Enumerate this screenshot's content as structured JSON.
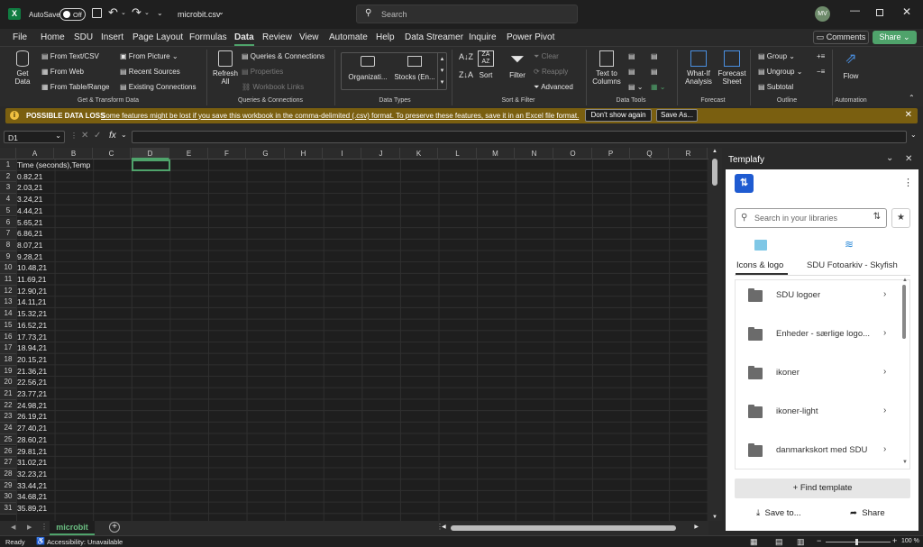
{
  "title_bar": {
    "autosave_label": "AutoSave",
    "autosave_state": "Off",
    "filename": "microbit.csv",
    "search_placeholder": "Search",
    "avatar_initials": "MV"
  },
  "menu_tabs": [
    "File",
    "Home",
    "SDU",
    "Insert",
    "Page Layout",
    "Formulas",
    "Data",
    "Review",
    "View",
    "Automate",
    "Help",
    "Data Streamer",
    "Inquire",
    "Power Pivot"
  ],
  "active_tab": "Data",
  "comments_label": "Comments",
  "share_label": "Share",
  "ribbon": {
    "get_data": "Get Data",
    "get_data_line1": "Get",
    "get_data_line2": "Data",
    "from_text_csv": "From Text/CSV",
    "from_web": "From Web",
    "from_table_range": "From Table/Range",
    "from_picture": "From Picture",
    "recent_sources": "Recent Sources",
    "existing_connections": "Existing Connections",
    "group_get_transform": "Get & Transform Data",
    "refresh_line1": "Refresh",
    "refresh_line2": "All",
    "queries_connections": "Queries & Connections",
    "properties": "Properties",
    "workbook_links": "Workbook Links",
    "group_queries": "Queries & Connections",
    "organization": "Organizati...",
    "stocks": "Stocks (En...",
    "group_data_types": "Data Types",
    "sort": "Sort",
    "filter": "Filter",
    "clear": "Clear",
    "reapply": "Reapply",
    "advanced": "Advanced",
    "group_sort_filter": "Sort & Filter",
    "text_to_columns_line1": "Text to",
    "text_to_columns_line2": "Columns",
    "group_data_tools": "Data Tools",
    "what_if_line1": "What-If",
    "what_if_line2": "Analysis",
    "forecast_line1": "Forecast",
    "forecast_line2": "Sheet",
    "group_forecast": "Forecast",
    "group": "Group",
    "ungroup": "Ungroup",
    "subtotal": "Subtotal",
    "group_outline": "Outline",
    "flow": "Flow",
    "group_automation": "Automation"
  },
  "banner": {
    "title": "POSSIBLE DATA LOSS",
    "message": "Some features might be lost if you save this workbook in the comma-delimited (.csv) format. To preserve these features, save it in an Excel file format.",
    "dont_show": "Don't show again",
    "save_as": "Save As..."
  },
  "formula_bar": {
    "name_box": "D1",
    "formula": ""
  },
  "columns": [
    "A",
    "B",
    "C",
    "D",
    "E",
    "F",
    "G",
    "H",
    "I",
    "J",
    "K",
    "L",
    "M",
    "N",
    "O",
    "P",
    "Q",
    "R"
  ],
  "rows": [
    {
      "n": "1",
      "a": "Time (seconds),Temp"
    },
    {
      "n": "2",
      "a": "0.82,21"
    },
    {
      "n": "3",
      "a": "2.03,21"
    },
    {
      "n": "4",
      "a": "3.24,21"
    },
    {
      "n": "5",
      "a": "4.44,21"
    },
    {
      "n": "6",
      "a": "5.65,21"
    },
    {
      "n": "7",
      "a": "6.86,21"
    },
    {
      "n": "8",
      "a": "8.07,21"
    },
    {
      "n": "9",
      "a": "9.28,21"
    },
    {
      "n": "10",
      "a": "10.48,21"
    },
    {
      "n": "11",
      "a": "11.69,21"
    },
    {
      "n": "12",
      "a": "12.90,21"
    },
    {
      "n": "13",
      "a": "14.11,21"
    },
    {
      "n": "14",
      "a": "15.32,21"
    },
    {
      "n": "15",
      "a": "16.52,21"
    },
    {
      "n": "16",
      "a": "17.73,21"
    },
    {
      "n": "17",
      "a": "18.94,21"
    },
    {
      "n": "18",
      "a": "20.15,21"
    },
    {
      "n": "19",
      "a": "21.36,21"
    },
    {
      "n": "20",
      "a": "22.56,21"
    },
    {
      "n": "21",
      "a": "23.77,21"
    },
    {
      "n": "22",
      "a": "24.98,21"
    },
    {
      "n": "23",
      "a": "26.19,21"
    },
    {
      "n": "24",
      "a": "27.40,21"
    },
    {
      "n": "25",
      "a": "28.60,21"
    },
    {
      "n": "26",
      "a": "29.81,21"
    },
    {
      "n": "27",
      "a": "31.02,21"
    },
    {
      "n": "28",
      "a": "32.23,21"
    },
    {
      "n": "29",
      "a": "33.44,21"
    },
    {
      "n": "30",
      "a": "34.68,21"
    },
    {
      "n": "31",
      "a": "35.89,21"
    }
  ],
  "sheet_tab": "microbit",
  "status": {
    "ready": "Ready",
    "accessibility": "Accessibility: Unavailable",
    "zoom": "100 %"
  },
  "pane": {
    "title": "Templafy",
    "search_placeholder": "Search in your libraries",
    "tab_icons": "Icons & logo",
    "tab_foto": "SDU Fotoarkiv - Skyfish",
    "folders": [
      "SDU logoer",
      "Enheder - særlige logo...",
      "ikoner",
      "ikoner-light",
      "danmarkskort med SDU"
    ],
    "find_template": "Find template",
    "save_to": "Save to...",
    "share": "Share"
  },
  "colors": {
    "excel_green": "#107c41",
    "share_green": "#4fa36b",
    "banner_bg": "#7a5f10",
    "templafy_blue": "#1f5bd1"
  }
}
